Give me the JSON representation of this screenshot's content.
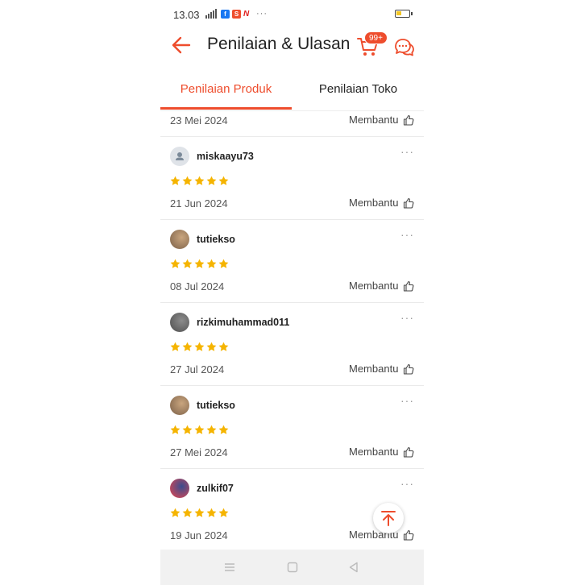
{
  "status_bar": {
    "time": "13.03",
    "more": "···",
    "battery_level": 0.4
  },
  "header": {
    "title": "Penilaian & Ulasan",
    "cart_badge": "99+",
    "back_icon": "arrow-left-icon",
    "cart_icon": "cart-icon",
    "chat_icon": "chat-icon"
  },
  "tabs": [
    {
      "label": "Penilaian Produk",
      "active": true
    },
    {
      "label": "Penilaian Toko",
      "active": false
    }
  ],
  "helpful_label": "Membantu",
  "top_partial": {
    "date": "23 Mei 2024"
  },
  "reviews": [
    {
      "username": "miskaayu73",
      "rating": 5,
      "date": "21 Jun 2024",
      "avatar": "default-user"
    },
    {
      "username": "tutiekso",
      "rating": 5,
      "date": "08 Jul 2024",
      "avatar": "photo"
    },
    {
      "username": "rizkimuhammad011",
      "rating": 5,
      "date": "27 Jul 2024",
      "avatar": "photo"
    },
    {
      "username": "tutiekso",
      "rating": 5,
      "date": "27 Mei 2024",
      "avatar": "photo"
    },
    {
      "username": "zulkif07",
      "rating": 5,
      "date": "19 Jun 2024",
      "avatar": "photo"
    }
  ],
  "colors": {
    "accent": "#ee4d2d",
    "star": "#f5b400"
  }
}
